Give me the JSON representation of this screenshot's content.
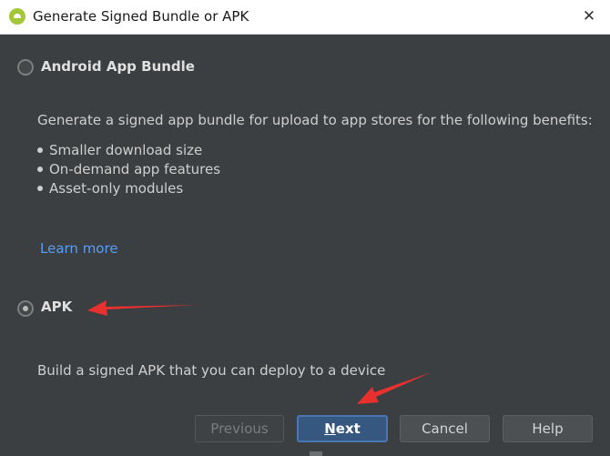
{
  "window": {
    "title": "Generate Signed Bundle or APK",
    "close_glyph": "✕",
    "app_icon": "android-studio-icon"
  },
  "options": {
    "bundle": {
      "label": "Android App Bundle",
      "selected": false,
      "description": "Generate a signed app bundle for upload to app stores for the following benefits:",
      "benefits": [
        "Smaller download size",
        "On-demand app features",
        "Asset-only modules"
      ],
      "learn_more": "Learn more"
    },
    "apk": {
      "label": "APK",
      "selected": true,
      "description": "Build a signed APK that you can deploy to a device"
    }
  },
  "buttons": {
    "previous": "Previous",
    "next_first": "N",
    "next_rest": "ext",
    "cancel": "Cancel",
    "help": "Help"
  },
  "colors": {
    "background": "#3c3f41",
    "link": "#589df6",
    "default_button": "#365880",
    "annotation_arrow": "#e8302f"
  }
}
